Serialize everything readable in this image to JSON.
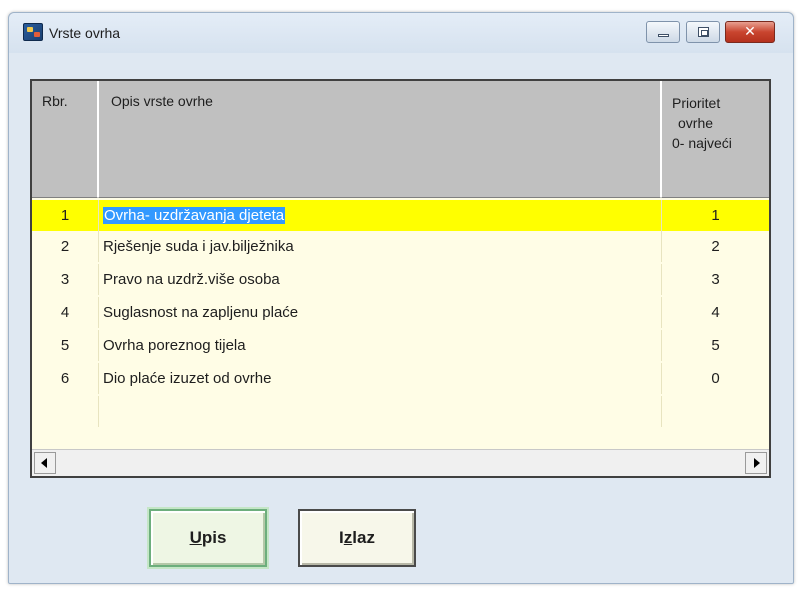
{
  "window": {
    "title": "Vrste ovrha",
    "close_glyph": "✕"
  },
  "grid": {
    "headers": {
      "rbr": "Rbr.",
      "opis": "Opis vrste ovrhe",
      "prio_line1": "Prioritet",
      "prio_line2": "ovrhe",
      "prio_line3": "0- najveći"
    },
    "rows": [
      {
        "rbr": "1",
        "opis": "Ovrha- uzdržavanja djeteta",
        "prio": "1",
        "selected": true
      },
      {
        "rbr": "2",
        "opis": "Rješenje suda i jav.bilježnika",
        "prio": "2"
      },
      {
        "rbr": "3",
        "opis": "Pravo na uzdrž.više osoba",
        "prio": "3"
      },
      {
        "rbr": "4",
        "opis": "Suglasnost na zapljenu plaće",
        "prio": "4"
      },
      {
        "rbr": "5",
        "opis": "Ovrha poreznog tijela",
        "prio": "5"
      },
      {
        "rbr": "6",
        "opis": "Dio plaće izuzet od ovrhe",
        "prio": "0"
      }
    ]
  },
  "buttons": {
    "upis": {
      "mnemonic": "U",
      "rest": "pis"
    },
    "izlaz": {
      "first": "I",
      "mnemonic": "z",
      "rest": "laz"
    }
  },
  "colors": {
    "selected_row": "#ffff00",
    "selection_text": "#3399ff",
    "grid_bg": "#fffde6",
    "header_bg": "#c0c0c0"
  },
  "icons": [
    "app-icon",
    "minimize-icon",
    "maximize-icon",
    "close-icon",
    "scroll-left-arrow-icon",
    "scroll-right-arrow-icon"
  ]
}
